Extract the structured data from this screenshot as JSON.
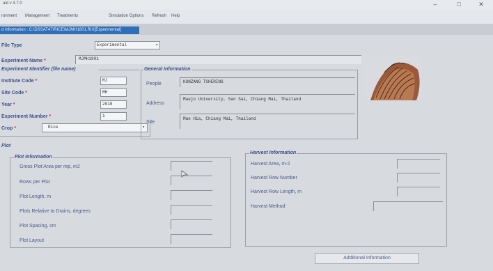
{
  "window": {
    "title": "aid v 4.7.0",
    "minimize": "–",
    "maximize": "□",
    "close": "✕"
  },
  "menu": [
    "ronment",
    "Management",
    "Treatments",
    "Simulation Options",
    "Refresh",
    "Help"
  ],
  "path": "d information : C:\\DSSAT47\\RICE\\MJMH1801.RIX[Experimental]",
  "file_type": {
    "label": "File Type",
    "value": "Experimental"
  },
  "experiment_name": {
    "label": "Experiment Name",
    "value": "MJMH1801"
  },
  "identifier": {
    "heading": "Experiment Identifier (file name)",
    "institute_label": "Institute Code",
    "institute_value": "MJ",
    "site_label": "Site Code",
    "site_value": "MH",
    "year_label": "Year",
    "year_value": "2018",
    "number_label": "Experiment Number",
    "number_value": "1",
    "crop_label": "Crop",
    "crop_value": "Rice"
  },
  "general": {
    "heading": "General Information",
    "people_label": "People",
    "people_value": "KUNZANG TSHERING",
    "address_label": "Address",
    "address_value": "Maejo University, San Sai, Chiang Mai, Thailand",
    "site_label": "Site",
    "site_value": "Mae Hia, Chiang Mai, Thailand"
  },
  "plot": {
    "section_label": "Plot",
    "heading": "Plot Information",
    "fields": [
      "Gross Plot Area per rep, m2",
      "Rows per Plot",
      "Plot Length, m",
      "Plots Relative to Drains, degrees",
      "Plot Spacing, cm",
      "Plot Layout"
    ]
  },
  "harvest": {
    "heading": "Harvest Information",
    "fields": [
      "Harvest Area, m-2",
      "Harvest Row Number",
      "Harvest Row Length, m",
      "Harvest Method"
    ]
  },
  "additional_button": "Additional Information",
  "required_mark": "*",
  "dropdown_arrow": "▾"
}
